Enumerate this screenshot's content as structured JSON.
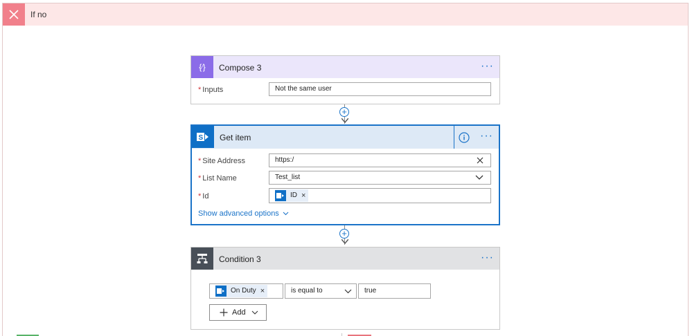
{
  "if_no": {
    "title": "If no"
  },
  "compose": {
    "title": "Compose 3",
    "fields": [
      {
        "label": "Inputs",
        "value": "Not the same user"
      }
    ]
  },
  "get_item": {
    "title": "Get item",
    "fields": [
      {
        "label": "Site Address",
        "value": "https:/"
      },
      {
        "label": "List Name",
        "value": "Test_list"
      },
      {
        "label": "Id",
        "token": "ID"
      }
    ],
    "advanced_label": "Show advanced options"
  },
  "condition": {
    "title": "Condition 3",
    "left_token": "On Duty",
    "operator": "is equal to",
    "right_value": "true",
    "add_label": "Add"
  },
  "colors": {
    "accent": "#1a73c8",
    "compose_icon": "#8b6ce8",
    "compose_header": "#ebe6fb",
    "sharepoint": "#0f6fc6",
    "condition_icon": "#484f58",
    "if_no_icon": "#f1808b"
  }
}
